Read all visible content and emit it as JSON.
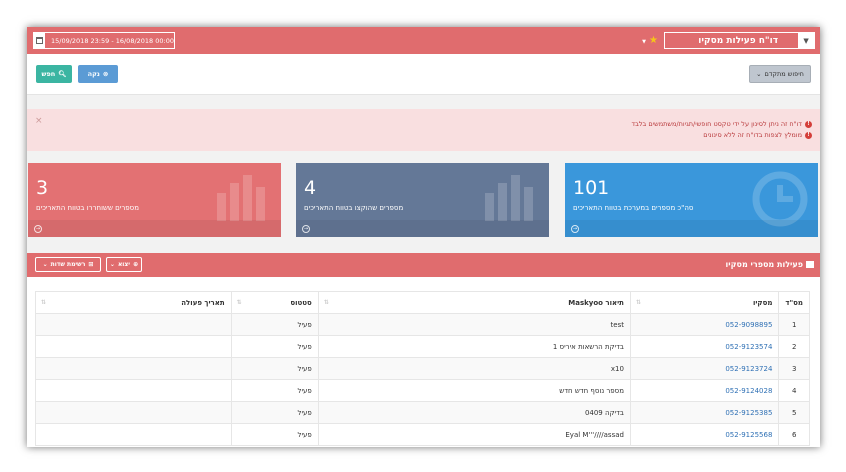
{
  "topbar": {
    "report_name": "דו\"ח פעילות מסקיו",
    "date_range": "15/09/2018 23:59 - 16/08/2018 00:00"
  },
  "toolbar": {
    "search_label": "חפש",
    "clear_label": "נקה",
    "advanced_label": "חיפוש מתקדם"
  },
  "alert": {
    "lines": [
      "דו\"ח זה ניתן לסינון על ידי טקסט חופשי/תגיות/משתמשים בלבד",
      "מומלץ לצפות בדו\"ח זה ללא סינונים"
    ],
    "close": "×"
  },
  "stats": [
    {
      "value": "3",
      "label": "מספרים ששוחררו בטווח התאריכים",
      "color": "#e37173"
    },
    {
      "value": "4",
      "label": "מספרים שהוקצו בטווח התאריכים",
      "color": "#647897"
    },
    {
      "value": "101",
      "label": "סה\"כ מספרים במערכת בטווח התאריכים",
      "color": "#3a97db"
    }
  ],
  "panel": {
    "title": "פעילות מספרי מסקיו",
    "export_label": "יצוא",
    "columns_label": "רשימת שדות"
  },
  "table": {
    "headers": [
      "מס\"ד",
      "מסקיו",
      "תיאור Maskyoo",
      "סטטוס",
      "תאריך פעולה"
    ],
    "rows": [
      [
        "1",
        "052-9098895",
        "test",
        "פעיל",
        ""
      ],
      [
        "2",
        "052-9123574",
        "בדיקת הרשאות איריס 1",
        "פעיל",
        ""
      ],
      [
        "3",
        "052-9123724",
        "x10",
        "פעיל",
        ""
      ],
      [
        "4",
        "052-9124028",
        "מספר נוסף חדש חדש",
        "פעיל",
        ""
      ],
      [
        "5",
        "052-9125385",
        "בדיקה 0409",
        "פעיל",
        ""
      ],
      [
        "6",
        "052-9125568",
        "Eyal M'''////assad",
        "פעיל",
        ""
      ]
    ]
  }
}
